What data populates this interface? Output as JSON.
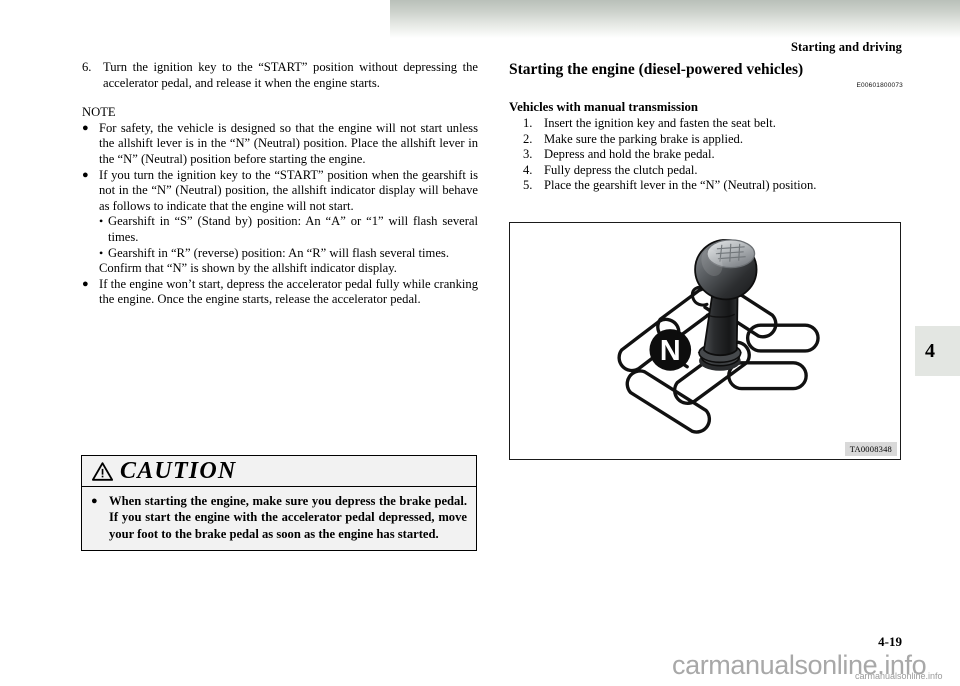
{
  "header": {
    "title": "Starting and driving",
    "chapter_tab": "4"
  },
  "left_column": {
    "step6": {
      "marker": "6.",
      "text": "Turn the ignition key to the “START” position without depressing the accelerator pedal, and release it when the engine starts."
    },
    "note_label": "NOTE",
    "notes": [
      {
        "dot": "●",
        "text": "For safety, the vehicle is designed so that the engine will not start unless the allshift lever is in the “N” (Neutral) position. Place the allshift lever in the “N” (Neutral) position before starting the engine."
      },
      {
        "dot": "●",
        "text": "If you turn the ignition key to the “START” position when the gearshift is not in the “N” (Neutral) position, the allshift indicator display will behave as follows to indicate that the engine will not start."
      }
    ],
    "sub_items": [
      {
        "dot": "•",
        "text": "Gearshift in “S” (Stand by) position: An “A” or “1” will flash several times."
      },
      {
        "dot": "•",
        "text": "Gearshift in “R” (reverse) position: An “R” will flash several times."
      }
    ],
    "confirm_text": "Confirm that “N” is shown by the allshift indicator display.",
    "note3": {
      "dot": "●",
      "text": "If the engine won’t start, depress the accelerator pedal fully while cranking the engine. Once the engine starts, release the accelerator pedal."
    }
  },
  "caution": {
    "icon": "warning-triangle-icon",
    "title": "CAUTION",
    "bullet_dot": "●",
    "text": "When starting the engine, make sure you depress the brake pedal. If you start the engine with the accelerator pedal depressed, move your foot to the brake pedal as soon as the engine has started."
  },
  "right_column": {
    "heading": "Starting the engine (diesel-powered vehicles)",
    "reference_code": "E00601800073",
    "subheading": "Vehicles with manual transmission",
    "steps": [
      {
        "marker": "1.",
        "text": "Insert the ignition key and fasten the seat belt."
      },
      {
        "marker": "2.",
        "text": "Make sure the parking brake is applied."
      },
      {
        "marker": "3.",
        "text": "Depress and hold the brake pedal."
      },
      {
        "marker": "4.",
        "text": "Fully depress the clutch pedal."
      },
      {
        "marker": "5.",
        "text": "Place the gearshift lever in the “N” (Neutral) position."
      }
    ],
    "figure": {
      "name": "manual-gearshift-lever-neutral-illustration",
      "neutral_label": "N",
      "figure_id": "TA0008348"
    }
  },
  "footer": {
    "page_number": "4-19",
    "watermark": "carmanualsonline.info",
    "watermark_small": "carmanualsonline.info"
  },
  "colors": {
    "caution_bg": "#f2f2f2",
    "tab_bg": "#e3e6e2",
    "figure_id_bg": "#d9d9d9",
    "watermark": "#a8a8a8"
  }
}
